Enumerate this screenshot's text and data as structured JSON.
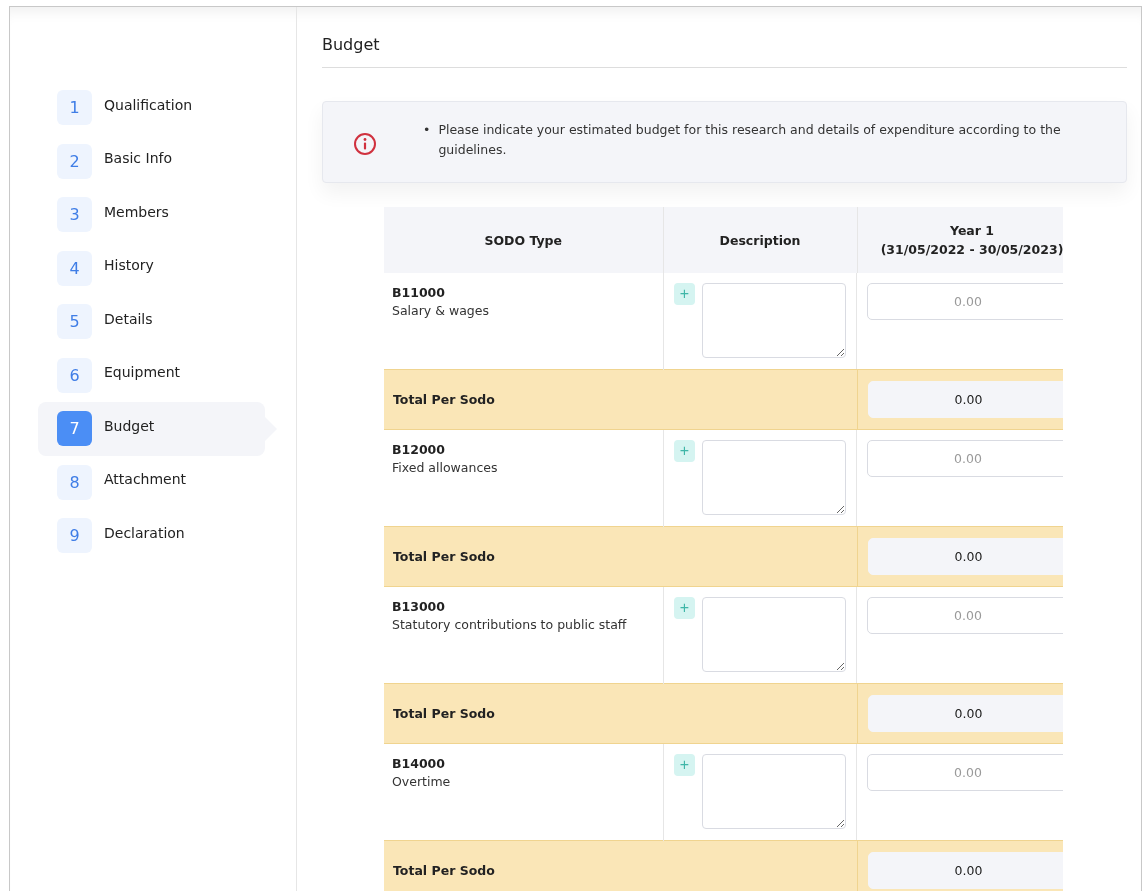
{
  "steps": [
    {
      "number": "1",
      "label": "Qualification",
      "selected": false
    },
    {
      "number": "2",
      "label": "Basic Info",
      "selected": false
    },
    {
      "number": "3",
      "label": "Members",
      "selected": false
    },
    {
      "number": "4",
      "label": "History",
      "selected": false
    },
    {
      "number": "5",
      "label": "Details",
      "selected": false
    },
    {
      "number": "6",
      "label": "Equipment",
      "selected": false
    },
    {
      "number": "7",
      "label": "Budget",
      "selected": true
    },
    {
      "number": "8",
      "label": "Attachment",
      "selected": false
    },
    {
      "number": "9",
      "label": "Declaration",
      "selected": false
    }
  ],
  "page_title": "Budget",
  "notice": {
    "items": [
      {
        "bullet": "•",
        "text": "Please indicate your estimated budget for this research and details of expenditure according to the guidelines."
      }
    ]
  },
  "table": {
    "columns": [
      {
        "label": "SODO Type"
      },
      {
        "label": "Description"
      },
      {
        "label": "Year 1",
        "sublabel": "(31/05/2022 - 30/05/2023)"
      }
    ],
    "sections": [
      {
        "code": "B11000",
        "name": "Salary & wages",
        "add_symbol": "+",
        "amount_placeholder": "0.00",
        "total_label": "Total Per Sodo",
        "total_value": "0.00"
      },
      {
        "code": "B12000",
        "name": "Fixed allowances",
        "add_symbol": "+",
        "amount_placeholder": "0.00",
        "total_label": "Total Per Sodo",
        "total_value": "0.00"
      },
      {
        "code": "B13000",
        "name": "Statutory contributions to public staff",
        "add_symbol": "+",
        "amount_placeholder": "0.00",
        "total_label": "Total Per Sodo",
        "total_value": "0.00"
      },
      {
        "code": "B14000",
        "name": "Overtime",
        "add_symbol": "+",
        "amount_placeholder": "0.00",
        "total_label": "Total Per Sodo",
        "total_value": "0.00"
      }
    ]
  }
}
